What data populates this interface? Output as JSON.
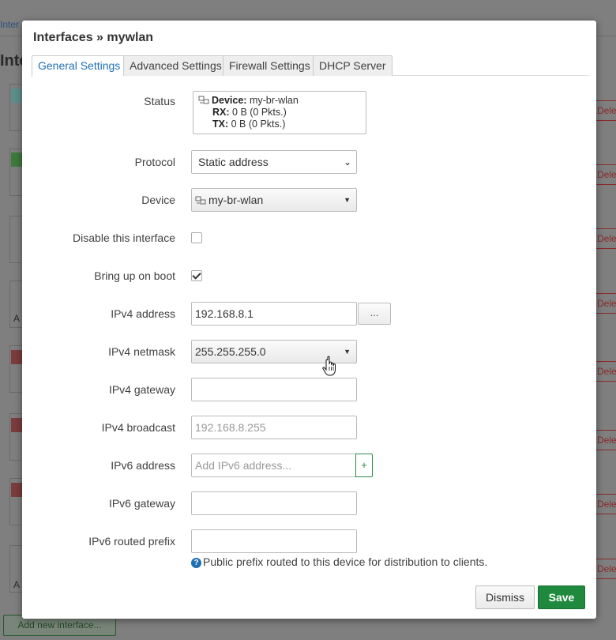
{
  "background": {
    "tab_fragment": "Inter",
    "heading_fragment": "Inte",
    "delete_fragment": "Delete",
    "add_button": "Add new interface...",
    "row_fragment_1": "A",
    "row_fragment_2": "A"
  },
  "modal": {
    "title": "Interfaces » mywlan",
    "tabs": [
      {
        "label": "General Settings",
        "active": true
      },
      {
        "label": "Advanced Settings",
        "active": false
      },
      {
        "label": "Firewall Settings",
        "active": false
      },
      {
        "label": "DHCP Server",
        "active": false
      }
    ]
  },
  "form": {
    "status": {
      "label": "Status",
      "device_key": "Device:",
      "device_value": "my-br-wlan",
      "rx_key": "RX:",
      "rx_value": "0 B (0 Pkts.)",
      "tx_key": "TX:",
      "tx_value": "0 B (0 Pkts.)"
    },
    "protocol": {
      "label": "Protocol",
      "value": "Static address"
    },
    "device": {
      "label": "Device",
      "value": "my-br-wlan"
    },
    "disable_interface": {
      "label": "Disable this interface",
      "checked": false
    },
    "bring_up_on_boot": {
      "label": "Bring up on boot",
      "checked": true
    },
    "ipv4_address": {
      "label": "IPv4 address",
      "value": "192.168.8.1",
      "more_button": "..."
    },
    "ipv4_netmask": {
      "label": "IPv4 netmask",
      "value": "255.255.255.0"
    },
    "ipv4_gateway": {
      "label": "IPv4 gateway",
      "value": ""
    },
    "ipv4_broadcast": {
      "label": "IPv4 broadcast",
      "placeholder": "192.168.8.255"
    },
    "ipv6_address": {
      "label": "IPv6 address",
      "placeholder": "Add IPv6 address...",
      "add_button": "+"
    },
    "ipv6_gateway": {
      "label": "IPv6 gateway",
      "value": ""
    },
    "ipv6_routed_prefix": {
      "label": "IPv6 routed prefix",
      "value": "",
      "help": "Public prefix routed to this device for distribution to clients."
    }
  },
  "footer": {
    "dismiss": "Dismiss",
    "save": "Save"
  },
  "colors": {
    "accent": "#1f6fb5",
    "save": "#1f8a3e",
    "overlay": "#7f7f7f"
  }
}
